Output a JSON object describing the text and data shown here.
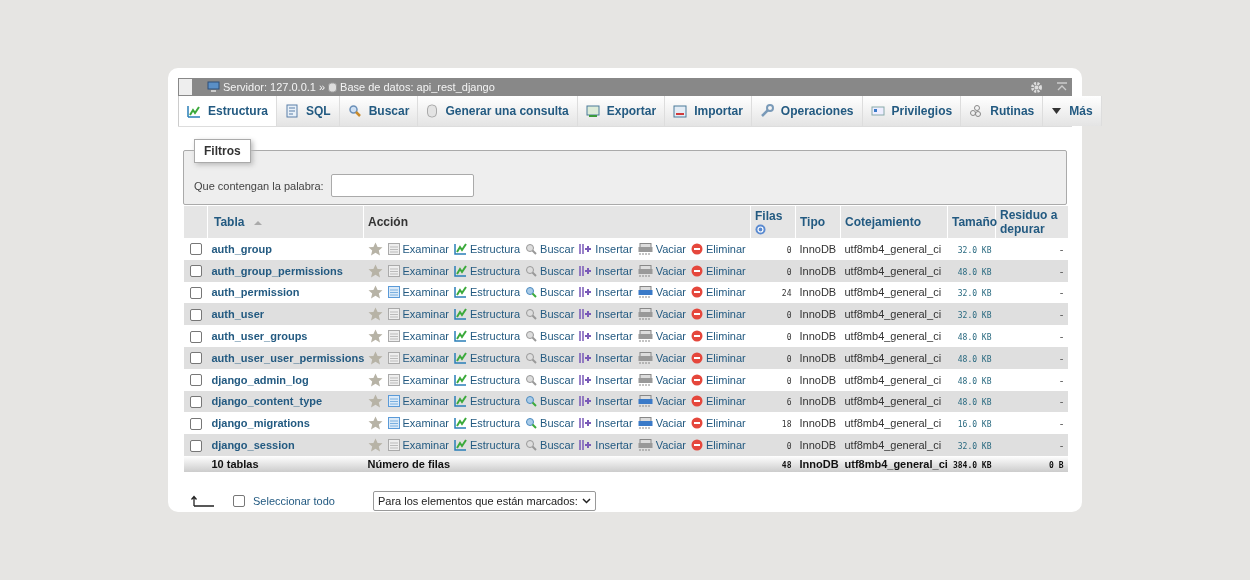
{
  "breadcrumb": {
    "server": "Servidor: 127.0.0.1",
    "separator": "»",
    "database": "Base de datos: api_rest_django"
  },
  "tabs": [
    {
      "label": "Estructura",
      "selected": true
    },
    {
      "label": "SQL",
      "selected": false
    },
    {
      "label": "Buscar",
      "selected": false
    },
    {
      "label": "Generar una consulta",
      "selected": false
    },
    {
      "label": "Exportar",
      "selected": false
    },
    {
      "label": "Importar",
      "selected": false
    },
    {
      "label": "Operaciones",
      "selected": false
    },
    {
      "label": "Privilegios",
      "selected": false
    },
    {
      "label": "Rutinas",
      "selected": false
    },
    {
      "label": "Más",
      "selected": false
    }
  ],
  "filters": {
    "legend": "Filtros",
    "label": "Que contengan la palabra:"
  },
  "table": {
    "columns": [
      "Tabla",
      "Acción",
      "Filas",
      "Tipo",
      "Cotejamiento",
      "Tamaño",
      "Residuo a depurar"
    ],
    "rows": [
      {
        "checked": false,
        "name": "auth_group",
        "empty": true,
        "actions": [
          "Examinar",
          "Estructura",
          "Buscar",
          "Insertar",
          "Vaciar",
          "Eliminar"
        ],
        "rows": "0",
        "engine": "InnoDB",
        "collation": "utf8mb4_general_ci",
        "size": "32.0 KB",
        "overhead": "-"
      },
      {
        "checked": false,
        "name": "auth_group_permissions",
        "empty": true,
        "actions": [
          "Examinar",
          "Estructura",
          "Buscar",
          "Insertar",
          "Vaciar",
          "Eliminar"
        ],
        "rows": "0",
        "engine": "InnoDB",
        "collation": "utf8mb4_general_ci",
        "size": "48.0 KB",
        "overhead": "-"
      },
      {
        "checked": false,
        "name": "auth_permission",
        "empty": false,
        "actions": [
          "Examinar",
          "Estructura",
          "Buscar",
          "Insertar",
          "Vaciar",
          "Eliminar"
        ],
        "rows": "24",
        "engine": "InnoDB",
        "collation": "utf8mb4_general_ci",
        "size": "32.0 KB",
        "overhead": "-"
      },
      {
        "checked": false,
        "name": "auth_user",
        "empty": true,
        "actions": [
          "Examinar",
          "Estructura",
          "Buscar",
          "Insertar",
          "Vaciar",
          "Eliminar"
        ],
        "rows": "0",
        "engine": "InnoDB",
        "collation": "utf8mb4_general_ci",
        "size": "32.0 KB",
        "overhead": "-"
      },
      {
        "checked": false,
        "name": "auth_user_groups",
        "empty": true,
        "actions": [
          "Examinar",
          "Estructura",
          "Buscar",
          "Insertar",
          "Vaciar",
          "Eliminar"
        ],
        "rows": "0",
        "engine": "InnoDB",
        "collation": "utf8mb4_general_ci",
        "size": "48.0 KB",
        "overhead": "-"
      },
      {
        "checked": false,
        "name": "auth_user_user_permissions",
        "empty": true,
        "actions": [
          "Examinar",
          "Estructura",
          "Buscar",
          "Insertar",
          "Vaciar",
          "Eliminar"
        ],
        "rows": "0",
        "engine": "InnoDB",
        "collation": "utf8mb4_general_ci",
        "size": "48.0 KB",
        "overhead": "-"
      },
      {
        "checked": false,
        "name": "django_admin_log",
        "empty": true,
        "actions": [
          "Examinar",
          "Estructura",
          "Buscar",
          "Insertar",
          "Vaciar",
          "Eliminar"
        ],
        "rows": "0",
        "engine": "InnoDB",
        "collation": "utf8mb4_general_ci",
        "size": "48.0 KB",
        "overhead": "-"
      },
      {
        "checked": false,
        "name": "django_content_type",
        "empty": false,
        "actions": [
          "Examinar",
          "Estructura",
          "Buscar",
          "Insertar",
          "Vaciar",
          "Eliminar"
        ],
        "rows": "6",
        "engine": "InnoDB",
        "collation": "utf8mb4_general_ci",
        "size": "48.0 KB",
        "overhead": "-"
      },
      {
        "checked": false,
        "name": "django_migrations",
        "empty": false,
        "actions": [
          "Examinar",
          "Estructura",
          "Buscar",
          "Insertar",
          "Vaciar",
          "Eliminar"
        ],
        "rows": "18",
        "engine": "InnoDB",
        "collation": "utf8mb4_general_ci",
        "size": "16.0 KB",
        "overhead": "-"
      },
      {
        "checked": false,
        "name": "django_session",
        "empty": true,
        "actions": [
          "Examinar",
          "Estructura",
          "Buscar",
          "Insertar",
          "Vaciar",
          "Eliminar"
        ],
        "rows": "0",
        "engine": "InnoDB",
        "collation": "utf8mb4_general_ci",
        "size": "32.0 KB",
        "overhead": "-"
      }
    ],
    "footer": {
      "count": "10 tablas",
      "label": "Número de filas",
      "rows": "48",
      "engine": "InnoDB",
      "collation": "utf8mb4_general_ci",
      "size": "384.0 KB",
      "overhead": "0 B"
    }
  },
  "bottom": {
    "select_all": {
      "label": "Seleccionar todo",
      "checked": false
    },
    "bulk_action": "Para los elementos que están marcados:"
  }
}
